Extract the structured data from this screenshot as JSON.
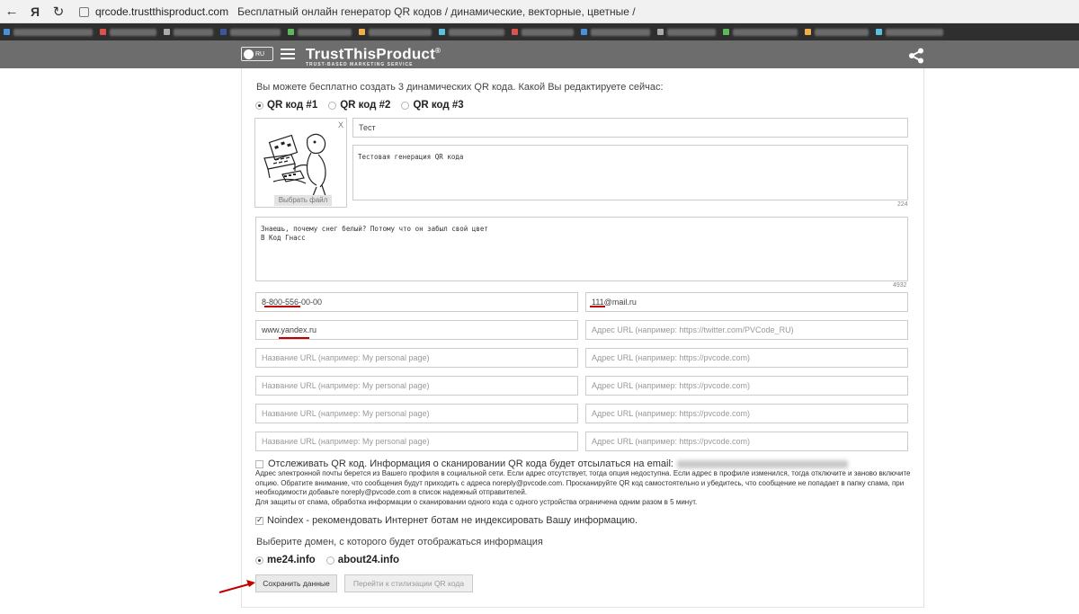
{
  "browser": {
    "back": "←",
    "yandex": "Я",
    "reload": "↻",
    "url_host": "qrcode.trustthisproduct.com",
    "page_title": "Бесплатный онлайн генератор QR кодов / динамические, векторные, цветные /"
  },
  "header": {
    "region": "RU",
    "brand": "TrustThisProduct",
    "reg": "®",
    "tagline": "TRUST-BASED MARKETING SERVICE"
  },
  "form": {
    "intro": "Вы можете бесплатно создать 3 динамических QR кода. Какой Вы редактируете сейчас:",
    "qr_options": [
      {
        "label": "QR код #1",
        "checked": true
      },
      {
        "label": "QR код #2",
        "checked": false
      },
      {
        "label": "QR код #3",
        "checked": false
      }
    ],
    "image": {
      "close": "X",
      "choose_file": "Выбрать файл"
    },
    "title_value": "Тест",
    "description_value": "Тестовая генерация QR кода",
    "description_counter": "224",
    "text_value": "Знаешь, почему снег белый? Потому что он забыл свой цвет\nВ Код Гнасс",
    "text_counter": "4932",
    "phone_value": "8-800-556-00-00",
    "email_value": "111@mail.ru",
    "website_value": "www.yandex.ru",
    "twitter_placeholder": "Адрес URL (например: https://twitter.com/PVCode_RU)",
    "url_name_placeholder": "Название URL (например: My personal page)",
    "url_placeholder": "Адрес URL (например: https://pvcode.com)",
    "track_label": "Отслеживать QR код. Информация о сканировании QR кода будет отсылаться на email:",
    "track_note_1": "Адрес электронной почты берется из Вашего профиля в социальной сети. Если адрес отсутствует, тогда опция недоступна. Если адрес в профиле изменился, тогда отключите и заново включите опцию. Обратите внимание, что сообщения будут приходить с адреса noreply@pvcode.com. Просканируйте QR код самостоятельно и убедитесь, что сообщение не попадает в папку спама, при необходимости добавьте noreply@pvcode.com в список надежный отправителей.",
    "track_note_2": "Для защиты от спама, обработка информации о сканировании одного кода с одного устройства ограничена одним разом в 5 минут.",
    "noindex_label": "Noindex - рекомендовать Интернет ботам не индексировать Вашу информацию.",
    "domain_title": "Выберите домен, с которого будет отображаться информация",
    "domains": [
      {
        "label": "me24.info",
        "checked": true
      },
      {
        "label": "about24.info",
        "checked": false
      }
    ],
    "save_button": "Сохранить данные",
    "style_button": "Перейти к стилизации QR кода"
  },
  "colors": {
    "header_bg": "#6d6d6d",
    "underline": "#c00000",
    "arrow": "#c00000"
  }
}
